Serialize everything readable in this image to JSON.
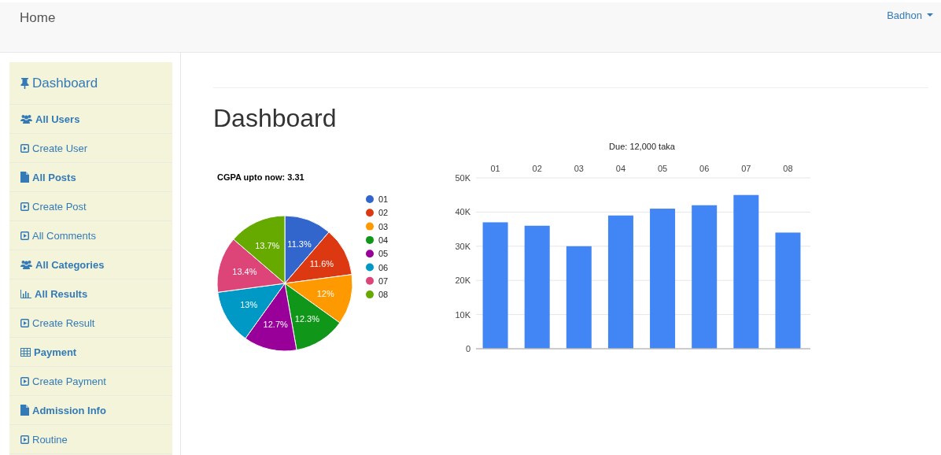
{
  "navbar": {
    "brand": "Home",
    "user": "Badhon"
  },
  "sidebar": {
    "items": [
      {
        "kind": "title",
        "label": "Dashboard"
      },
      {
        "kind": "people",
        "label": "All Users"
      },
      {
        "kind": "link",
        "label": "Create User"
      },
      {
        "kind": "page",
        "label": "All Posts"
      },
      {
        "kind": "link",
        "label": "Create Post"
      },
      {
        "kind": "link",
        "label": "All Comments"
      },
      {
        "kind": "people",
        "label": "All Categories"
      },
      {
        "kind": "stats",
        "label": "All Results"
      },
      {
        "kind": "link",
        "label": "Create Result"
      },
      {
        "kind": "grid",
        "label": "Payment"
      },
      {
        "kind": "link",
        "label": "Create Payment"
      },
      {
        "kind": "page",
        "label": "Admission Info"
      },
      {
        "kind": "link",
        "label": "Routine"
      }
    ]
  },
  "main": {
    "title": "Dashboard",
    "pie": {
      "chart_data": {
        "type": "pie",
        "title": "CGPA upto now: 3.31",
        "categories": [
          "01",
          "02",
          "03",
          "04",
          "05",
          "06",
          "07",
          "08"
        ],
        "values": [
          11.3,
          11.6,
          12,
          12.3,
          12.7,
          13,
          13.4,
          13.7
        ],
        "legend": "right",
        "colors": [
          "#3366cc",
          "#dc3912",
          "#ff9900",
          "#109618",
          "#990099",
          "#0099c6",
          "#dd4477",
          "#66aa00"
        ],
        "value_labels": [
          "11.3%",
          "11.6%",
          "12%",
          "12.3%",
          "12.7%",
          "13%",
          "13.4%",
          "13.7%"
        ]
      }
    },
    "bar": {
      "chart_data": {
        "type": "bar",
        "title": "Due: 12,000 taka",
        "categories": [
          "01",
          "02",
          "03",
          "04",
          "05",
          "06",
          "07",
          "08"
        ],
        "values": [
          37000,
          36000,
          30000,
          39000,
          41000,
          42000,
          45000,
          34000
        ],
        "color": "#4285f4",
        "grid": true,
        "ylim": [
          0,
          50000
        ],
        "yticks": [
          {
            "value": 0,
            "label": "0"
          },
          {
            "value": 10000,
            "label": "10K"
          },
          {
            "value": 20000,
            "label": "20K"
          },
          {
            "value": 30000,
            "label": "30K"
          },
          {
            "value": 40000,
            "label": "40K"
          },
          {
            "value": 50000,
            "label": "50K"
          }
        ]
      }
    }
  }
}
